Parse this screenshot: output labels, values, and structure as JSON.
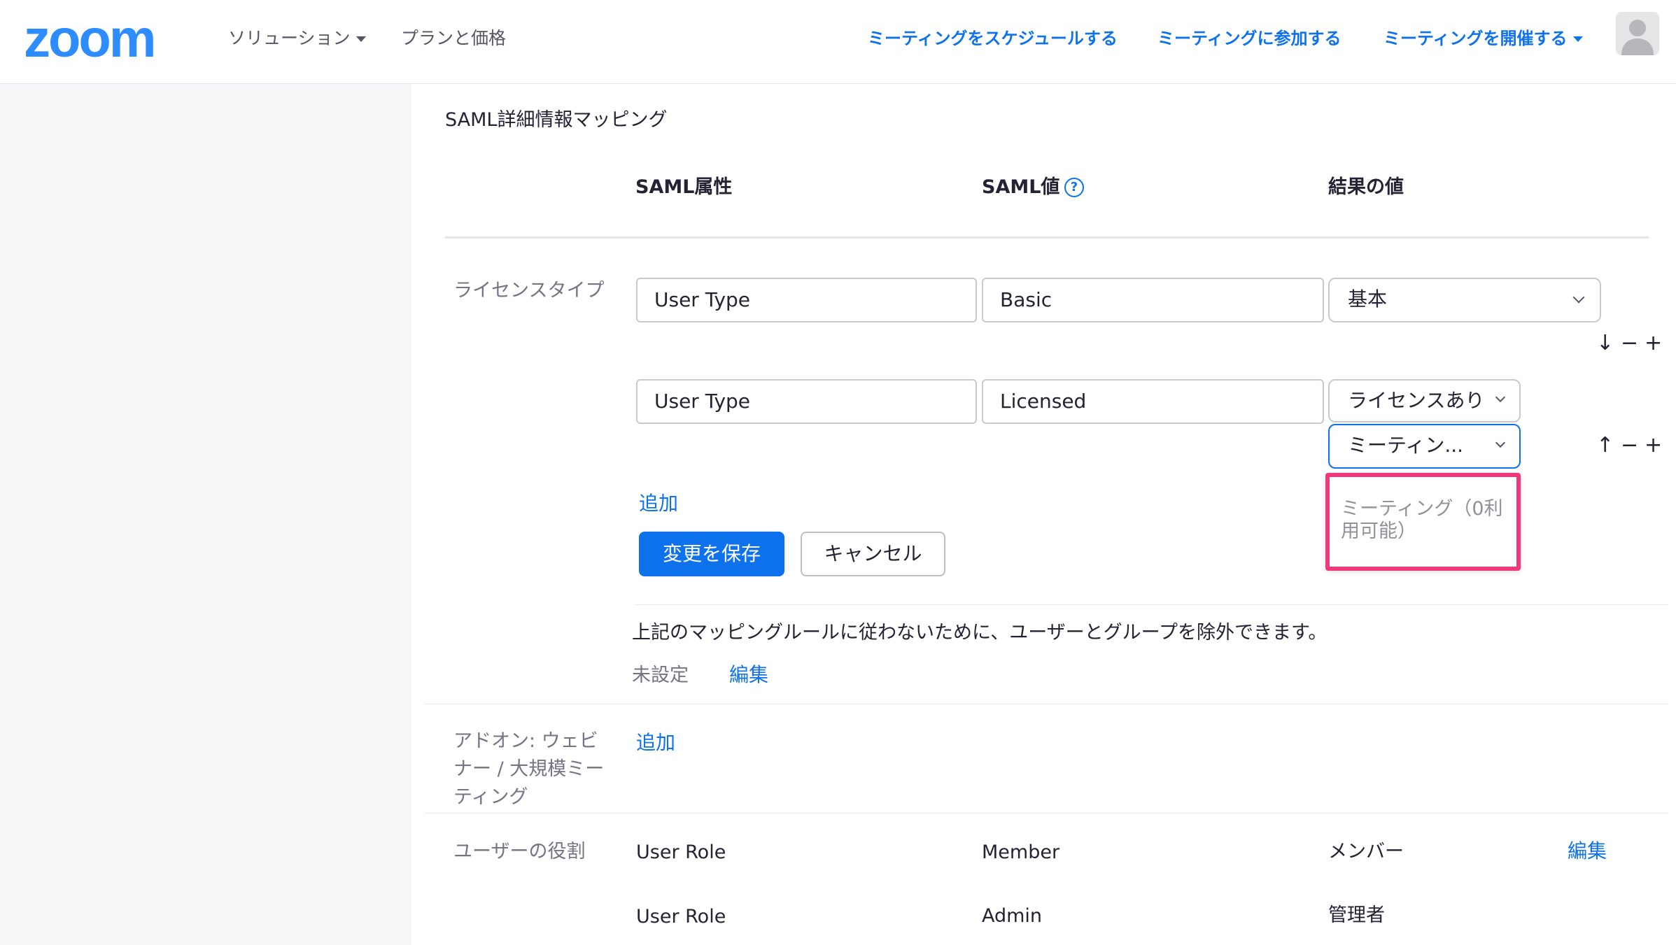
{
  "header": {
    "logo": "zoom",
    "nav_left": [
      {
        "label": "ソリューション",
        "has_caret": true
      },
      {
        "label": "プランと価格",
        "has_caret": false
      }
    ],
    "nav_right": [
      {
        "label": "ミーティングをスケジュールする"
      },
      {
        "label": "ミーティングに参加する"
      },
      {
        "label": "ミーティングを開催する",
        "has_caret": true
      }
    ]
  },
  "section": {
    "title": "SAML詳細情報マッピング",
    "columns": {
      "attribute": "SAML属性",
      "value": "SAML値",
      "result": "結果の値"
    },
    "help_icon": "?"
  },
  "license": {
    "label": "ライセンスタイプ",
    "rows": [
      {
        "attribute": "User Type",
        "value": "Basic",
        "result": "基本"
      },
      {
        "attribute": "User Type",
        "value": "Licensed",
        "result": "ライセンスあり",
        "sub_result": "ミーティン..."
      }
    ],
    "controls_row1": {
      "move": "↓",
      "remove": "−",
      "add": "+"
    },
    "controls_row2": {
      "move": "↑",
      "remove": "−",
      "add": "+"
    },
    "dropdown_option": "ミーティング（0利用可能）",
    "add_link": "追加",
    "save_button": "変更を保存",
    "cancel_button": "キャンセル"
  },
  "exclusion": {
    "text": "上記のマッピングルールに従わないために、ユーザーとグループを除外できます。",
    "status": "未設定",
    "edit_link": "編集"
  },
  "addon": {
    "label_lines": [
      "アドオン: ウェビ",
      "ナー / 大規模ミー",
      "ティング"
    ],
    "add_link": "追加"
  },
  "user_role": {
    "label": "ユーザーの役割",
    "rows": [
      {
        "attribute": "User Role",
        "value": "Member",
        "result": "メンバー"
      },
      {
        "attribute": "User Role",
        "value": "Admin",
        "result": "管理者"
      }
    ],
    "edit_link": "編集"
  },
  "colors": {
    "brand": "#2d8cff",
    "link": "#0e72ed",
    "highlight": "#f0387c"
  }
}
